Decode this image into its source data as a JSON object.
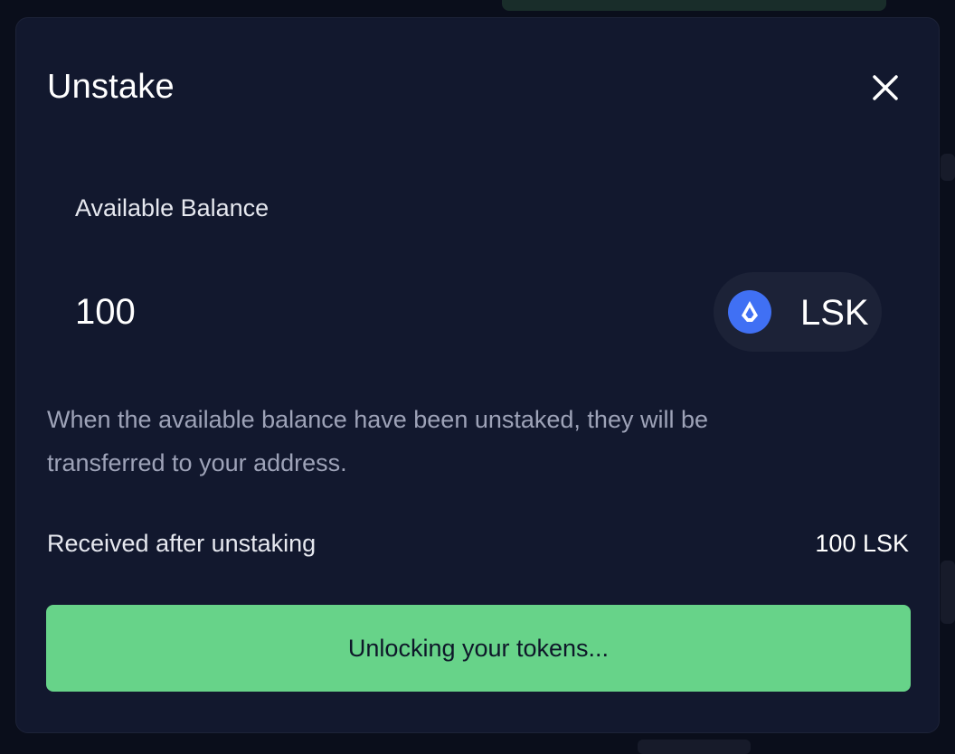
{
  "modal": {
    "title": "Unstake",
    "balance_label": "Available Balance",
    "balance_value": "100",
    "token_symbol": "LSK",
    "info_text": "When the available balance have been unstaked, they will be transferred to your address.",
    "received_label": "Received after unstaking",
    "received_value": "100 LSK",
    "button_label": "Unlocking your tokens...",
    "icons": {
      "close": "close-icon",
      "token": "lisk-token-icon"
    }
  },
  "colors": {
    "modal_background": "#12182e",
    "button_green": "#67d389",
    "token_blue": "#4070f4",
    "muted_text": "#9ea3b8"
  }
}
